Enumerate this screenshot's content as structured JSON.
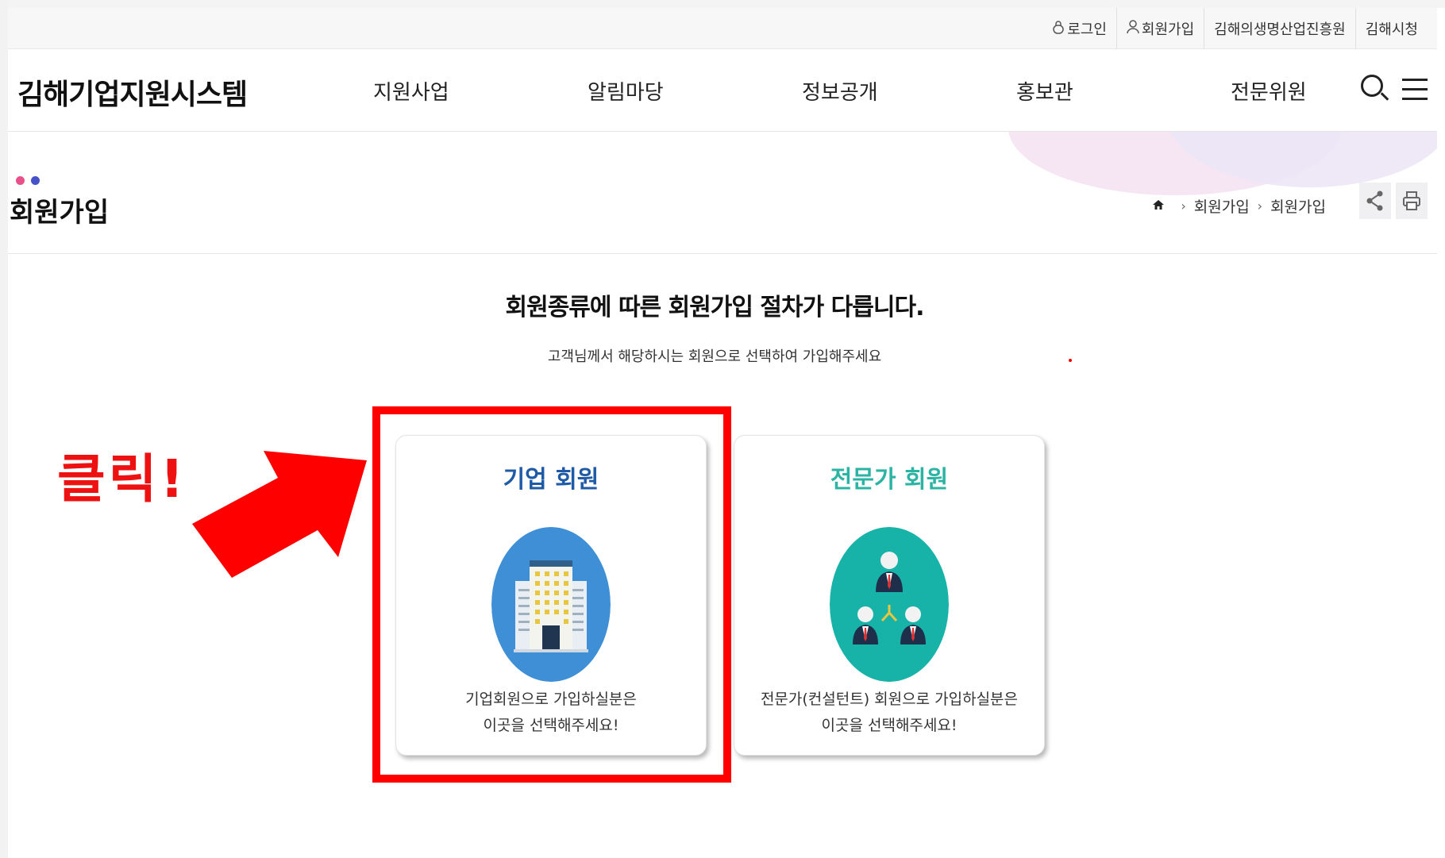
{
  "utility": {
    "login": "로그인",
    "join": "회원가입",
    "institute": "김해의생명산업진흥원",
    "city": "김해시청"
  },
  "header": {
    "logo": "김해기업지원시스템",
    "menu": [
      "지원사업",
      "알림마당",
      "정보공개",
      "홍보관",
      "전문위원"
    ]
  },
  "page": {
    "title": "회원가입",
    "breadcrumb": [
      "회원가입",
      "회원가입"
    ],
    "dot_colors": [
      "#e8508a",
      "#4650c8"
    ]
  },
  "main": {
    "headline": "회원종류에 따른 회원가입 절차가 다릅니다.",
    "subline": "고객님께서 해당하시는 회원으로 선택하여 가입해주세요"
  },
  "cards": [
    {
      "title": "기업 회원",
      "title_color": "#1f5aa6",
      "circle_color": "#3f8fd6",
      "icon": "office-building-icon",
      "desc_line1": "기업회원으로 가입하실분은",
      "desc_line2": "이곳을 선택해주세요!"
    },
    {
      "title": "전문가 회원",
      "title_color": "#2bb3a3",
      "circle_color": "#17b3a8",
      "icon": "expert-network-icon",
      "desc_line1": "전문가(컨설턴트) 회원으로 가입하실분은",
      "desc_line2": "이곳을 선택해주세요!"
    }
  ],
  "annotation": {
    "text": "클릭!",
    "color": "#ff0000"
  }
}
